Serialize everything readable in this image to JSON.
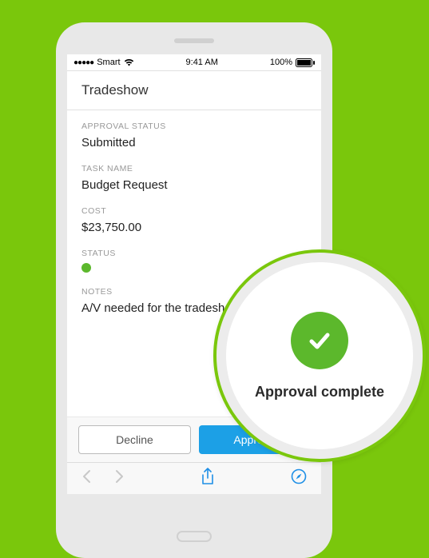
{
  "statusbar": {
    "carrier": "Smart",
    "time": "9:41 AM",
    "battery": "100%"
  },
  "header": {
    "title": "Tradeshow"
  },
  "fields": {
    "approval_status": {
      "label": "APPROVAL STATUS",
      "value": "Submitted"
    },
    "task_name": {
      "label": "TASK NAME",
      "value": "Budget Request"
    },
    "cost": {
      "label": "COST",
      "value": "$23,750.00"
    },
    "status": {
      "label": "STATUS",
      "dot_color": "#5cb82c"
    },
    "notes": {
      "label": "NOTES",
      "value": "A/V needed for the tradeshow"
    }
  },
  "actions": {
    "decline": "Decline",
    "approve": "Approve"
  },
  "callout": {
    "text": "Approval complete"
  }
}
